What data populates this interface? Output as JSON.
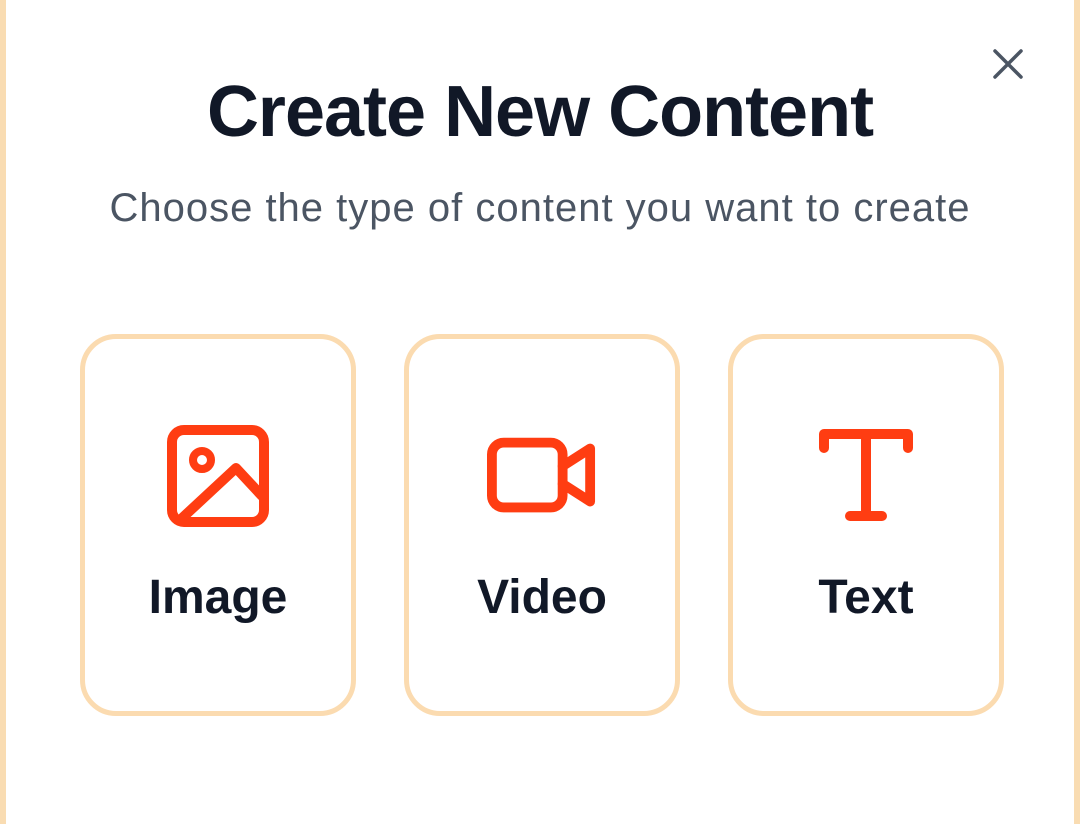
{
  "dialog": {
    "title": "Create New Content",
    "subtitle": "Choose the type of content you want to create",
    "close_icon": "close-icon"
  },
  "options": [
    {
      "label": "Image",
      "icon": "image-icon"
    },
    {
      "label": "Video",
      "icon": "video-camera-icon"
    },
    {
      "label": "Text",
      "icon": "text-type-icon"
    }
  ],
  "colors": {
    "accent": "#ff3d12",
    "card_border": "#fbdbb0",
    "title": "#111827",
    "subtitle": "#4b5563"
  }
}
